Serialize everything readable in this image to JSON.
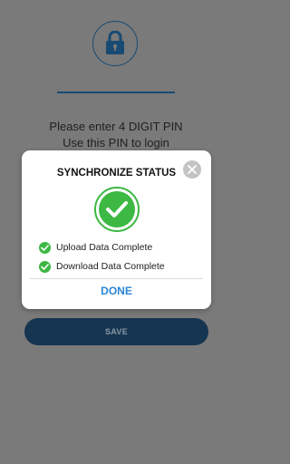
{
  "lock": {
    "icon": "lock-icon"
  },
  "prompt": {
    "line1": "Please enter 4 DIGIT PIN",
    "line2": "Use this PIN to login"
  },
  "save_button": {
    "label": "SAVE"
  },
  "dialog": {
    "title": "SYNCHRONIZE STATUS",
    "close_icon": "close-icon",
    "status_icon": "check-circle-icon",
    "items": [
      {
        "label": "Upload Data Complete",
        "icon": "check-icon"
      },
      {
        "label": "Download Data Complete",
        "icon": "check-icon"
      }
    ],
    "done_label": "DONE"
  },
  "colors": {
    "overlay_background": "#7a7a7a",
    "primary_dark": "#163550",
    "accent_blue": "#2a86d6",
    "success_green": "#3cb843"
  }
}
